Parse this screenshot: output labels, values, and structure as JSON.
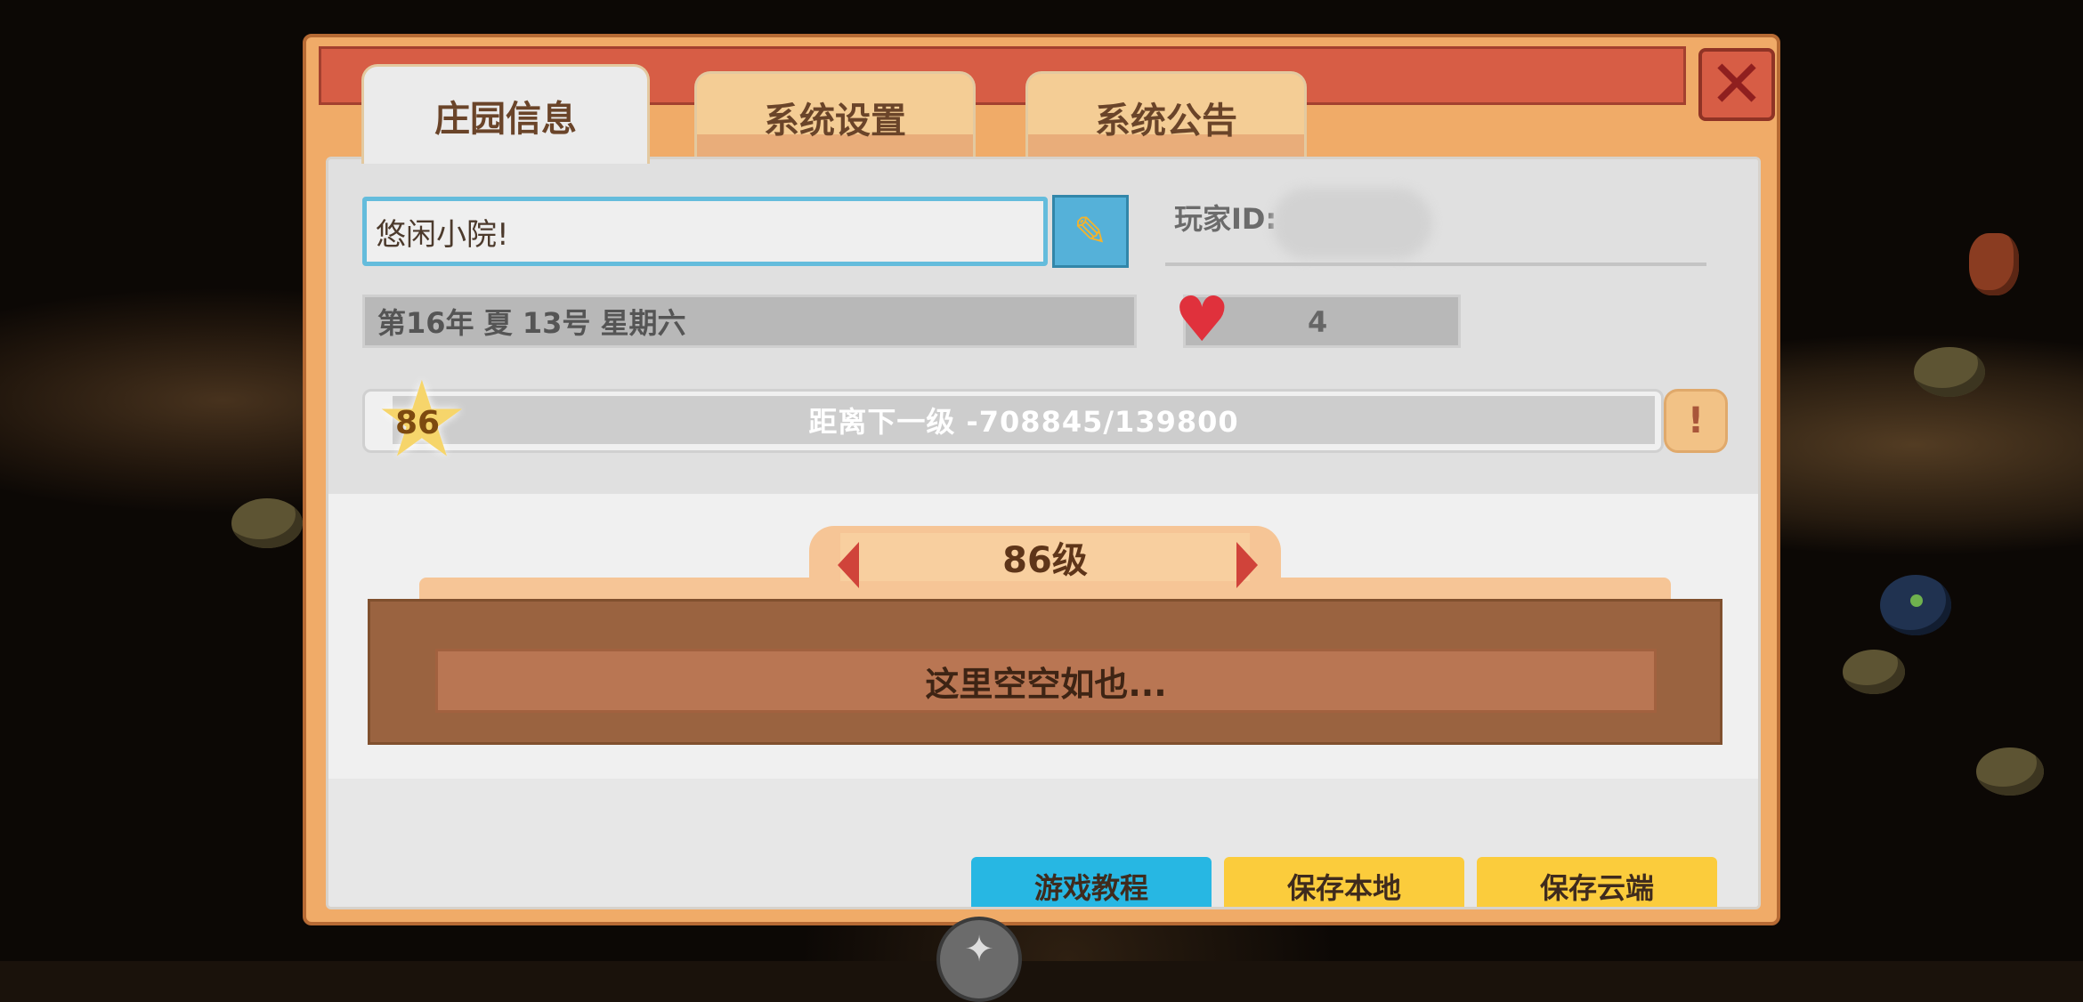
{
  "tabs": [
    {
      "label": "庄园信息",
      "active": true
    },
    {
      "label": "系统设置",
      "active": false
    },
    {
      "label": "系统公告",
      "active": false
    }
  ],
  "close_icon": "close-icon",
  "farm": {
    "name": "悠闲小院!",
    "player_id_label": "玩家ID:",
    "date_text": "第16年  夏  13号 星期六",
    "hearts": "4"
  },
  "level": {
    "current": "86",
    "progress_text": "距离下一级   -708845/139800",
    "info_icon": "!",
    "selector_label": "86级",
    "empty_text": "这里空空如也..."
  },
  "buttons": {
    "tutorial": "游戏教程",
    "save_local": "保存本地",
    "save_cloud": "保存云端"
  },
  "colors": {
    "frame": "#f0ab68",
    "title_bar": "#d75d45",
    "tutorial_button": "#27b7e3",
    "save_button": "#fbcc3c",
    "heart": "#e0313c"
  }
}
